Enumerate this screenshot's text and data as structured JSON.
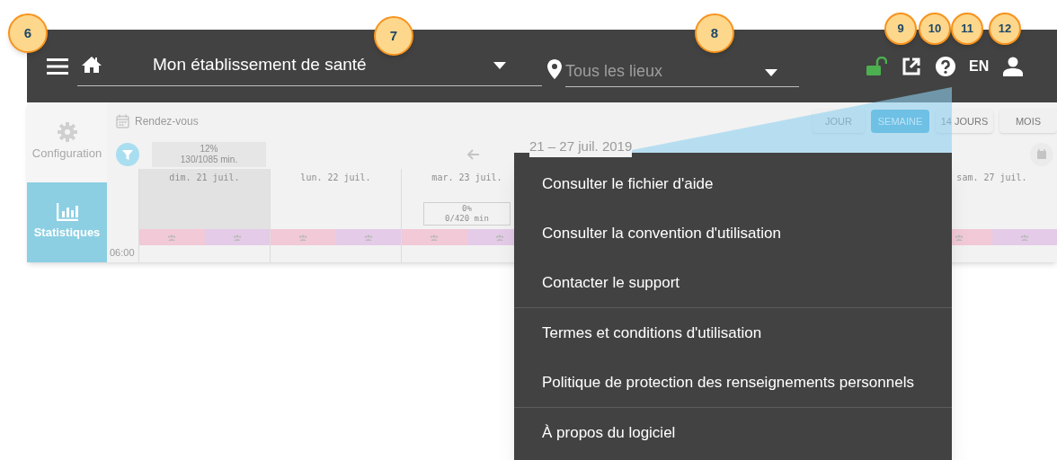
{
  "callouts": [
    "6",
    "7",
    "8",
    "9",
    "10",
    "11",
    "12"
  ],
  "app_bar": {
    "establishment": "Mon établissement de santé",
    "location_placeholder": "Tous les lieux",
    "language": "EN",
    "lock": {
      "locked": false
    }
  },
  "sidebar": {
    "items": [
      {
        "label": "Configuration",
        "kind": "settings",
        "selected": false
      },
      {
        "label": "Statistiques",
        "kind": "stats",
        "selected": true
      }
    ]
  },
  "calendar": {
    "title": "Rendez-vous",
    "view_tabs": [
      {
        "label": "JOUR",
        "selected": false
      },
      {
        "label": "SEMAINE",
        "selected": true
      },
      {
        "label": "14 JOURS",
        "selected": false
      },
      {
        "label": "MOIS",
        "selected": false
      }
    ],
    "summary": {
      "percent": "12%",
      "minutes": "130/1085 min."
    },
    "range": "21 – 27 juil. 2019",
    "days": [
      {
        "label": "dim. 21 juil.",
        "unavailable": true,
        "slots": [
          {
            "color": "#f2c9d6"
          },
          {
            "color": "#e4cbe8"
          }
        ]
      },
      {
        "label": "lun. 22 juil.",
        "unavailable": false,
        "slots": [
          {
            "color": "#f2c9d6"
          },
          {
            "color": "#e4cbe8"
          }
        ]
      },
      {
        "label": "mar. 23 juil.",
        "unavailable": false,
        "usage": {
          "percent": "0%",
          "minutes": "0/420 min"
        },
        "slots": [
          {
            "color": "#f2c9d6"
          },
          {
            "color": "#e4cbe8"
          }
        ]
      },
      {
        "label": "sam. 27 juil.",
        "unavailable": false,
        "slots": [
          {
            "color": "#f2c9d6"
          },
          {
            "color": "#e4cbe8"
          }
        ]
      }
    ],
    "first_hour": "06:00"
  },
  "help_menu": {
    "items": [
      {
        "label": "Consulter le fichier d'aide",
        "divider_before": false
      },
      {
        "label": "Consulter la convention d'utilisation",
        "divider_before": false
      },
      {
        "label": "Contacter le support",
        "divider_before": false
      },
      {
        "label": "Termes et conditions d'utilisation",
        "divider_before": true
      },
      {
        "label": "Politique de protection des renseignements personnels",
        "divider_before": false
      },
      {
        "label": "À propos du logiciel",
        "divider_before": true
      }
    ]
  }
}
